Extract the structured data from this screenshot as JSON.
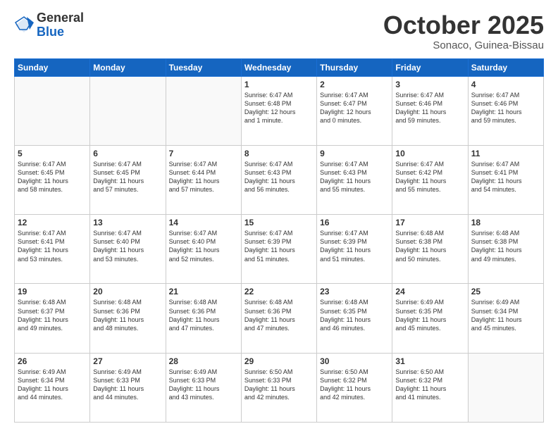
{
  "logo": {
    "general": "General",
    "blue": "Blue"
  },
  "header": {
    "month": "October 2025",
    "location": "Sonaco, Guinea-Bissau"
  },
  "days_of_week": [
    "Sunday",
    "Monday",
    "Tuesday",
    "Wednesday",
    "Thursday",
    "Friday",
    "Saturday"
  ],
  "weeks": [
    [
      {
        "day": "",
        "info": ""
      },
      {
        "day": "",
        "info": ""
      },
      {
        "day": "",
        "info": ""
      },
      {
        "day": "1",
        "info": "Sunrise: 6:47 AM\nSunset: 6:48 PM\nDaylight: 12 hours\nand 1 minute."
      },
      {
        "day": "2",
        "info": "Sunrise: 6:47 AM\nSunset: 6:47 PM\nDaylight: 12 hours\nand 0 minutes."
      },
      {
        "day": "3",
        "info": "Sunrise: 6:47 AM\nSunset: 6:46 PM\nDaylight: 11 hours\nand 59 minutes."
      },
      {
        "day": "4",
        "info": "Sunrise: 6:47 AM\nSunset: 6:46 PM\nDaylight: 11 hours\nand 59 minutes."
      }
    ],
    [
      {
        "day": "5",
        "info": "Sunrise: 6:47 AM\nSunset: 6:45 PM\nDaylight: 11 hours\nand 58 minutes."
      },
      {
        "day": "6",
        "info": "Sunrise: 6:47 AM\nSunset: 6:45 PM\nDaylight: 11 hours\nand 57 minutes."
      },
      {
        "day": "7",
        "info": "Sunrise: 6:47 AM\nSunset: 6:44 PM\nDaylight: 11 hours\nand 57 minutes."
      },
      {
        "day": "8",
        "info": "Sunrise: 6:47 AM\nSunset: 6:43 PM\nDaylight: 11 hours\nand 56 minutes."
      },
      {
        "day": "9",
        "info": "Sunrise: 6:47 AM\nSunset: 6:43 PM\nDaylight: 11 hours\nand 55 minutes."
      },
      {
        "day": "10",
        "info": "Sunrise: 6:47 AM\nSunset: 6:42 PM\nDaylight: 11 hours\nand 55 minutes."
      },
      {
        "day": "11",
        "info": "Sunrise: 6:47 AM\nSunset: 6:41 PM\nDaylight: 11 hours\nand 54 minutes."
      }
    ],
    [
      {
        "day": "12",
        "info": "Sunrise: 6:47 AM\nSunset: 6:41 PM\nDaylight: 11 hours\nand 53 minutes."
      },
      {
        "day": "13",
        "info": "Sunrise: 6:47 AM\nSunset: 6:40 PM\nDaylight: 11 hours\nand 53 minutes."
      },
      {
        "day": "14",
        "info": "Sunrise: 6:47 AM\nSunset: 6:40 PM\nDaylight: 11 hours\nand 52 minutes."
      },
      {
        "day": "15",
        "info": "Sunrise: 6:47 AM\nSunset: 6:39 PM\nDaylight: 11 hours\nand 51 minutes."
      },
      {
        "day": "16",
        "info": "Sunrise: 6:47 AM\nSunset: 6:39 PM\nDaylight: 11 hours\nand 51 minutes."
      },
      {
        "day": "17",
        "info": "Sunrise: 6:48 AM\nSunset: 6:38 PM\nDaylight: 11 hours\nand 50 minutes."
      },
      {
        "day": "18",
        "info": "Sunrise: 6:48 AM\nSunset: 6:38 PM\nDaylight: 11 hours\nand 49 minutes."
      }
    ],
    [
      {
        "day": "19",
        "info": "Sunrise: 6:48 AM\nSunset: 6:37 PM\nDaylight: 11 hours\nand 49 minutes."
      },
      {
        "day": "20",
        "info": "Sunrise: 6:48 AM\nSunset: 6:36 PM\nDaylight: 11 hours\nand 48 minutes."
      },
      {
        "day": "21",
        "info": "Sunrise: 6:48 AM\nSunset: 6:36 PM\nDaylight: 11 hours\nand 47 minutes."
      },
      {
        "day": "22",
        "info": "Sunrise: 6:48 AM\nSunset: 6:36 PM\nDaylight: 11 hours\nand 47 minutes."
      },
      {
        "day": "23",
        "info": "Sunrise: 6:48 AM\nSunset: 6:35 PM\nDaylight: 11 hours\nand 46 minutes."
      },
      {
        "day": "24",
        "info": "Sunrise: 6:49 AM\nSunset: 6:35 PM\nDaylight: 11 hours\nand 45 minutes."
      },
      {
        "day": "25",
        "info": "Sunrise: 6:49 AM\nSunset: 6:34 PM\nDaylight: 11 hours\nand 45 minutes."
      }
    ],
    [
      {
        "day": "26",
        "info": "Sunrise: 6:49 AM\nSunset: 6:34 PM\nDaylight: 11 hours\nand 44 minutes."
      },
      {
        "day": "27",
        "info": "Sunrise: 6:49 AM\nSunset: 6:33 PM\nDaylight: 11 hours\nand 44 minutes."
      },
      {
        "day": "28",
        "info": "Sunrise: 6:49 AM\nSunset: 6:33 PM\nDaylight: 11 hours\nand 43 minutes."
      },
      {
        "day": "29",
        "info": "Sunrise: 6:50 AM\nSunset: 6:33 PM\nDaylight: 11 hours\nand 42 minutes."
      },
      {
        "day": "30",
        "info": "Sunrise: 6:50 AM\nSunset: 6:32 PM\nDaylight: 11 hours\nand 42 minutes."
      },
      {
        "day": "31",
        "info": "Sunrise: 6:50 AM\nSunset: 6:32 PM\nDaylight: 11 hours\nand 41 minutes."
      },
      {
        "day": "",
        "info": ""
      }
    ]
  ]
}
